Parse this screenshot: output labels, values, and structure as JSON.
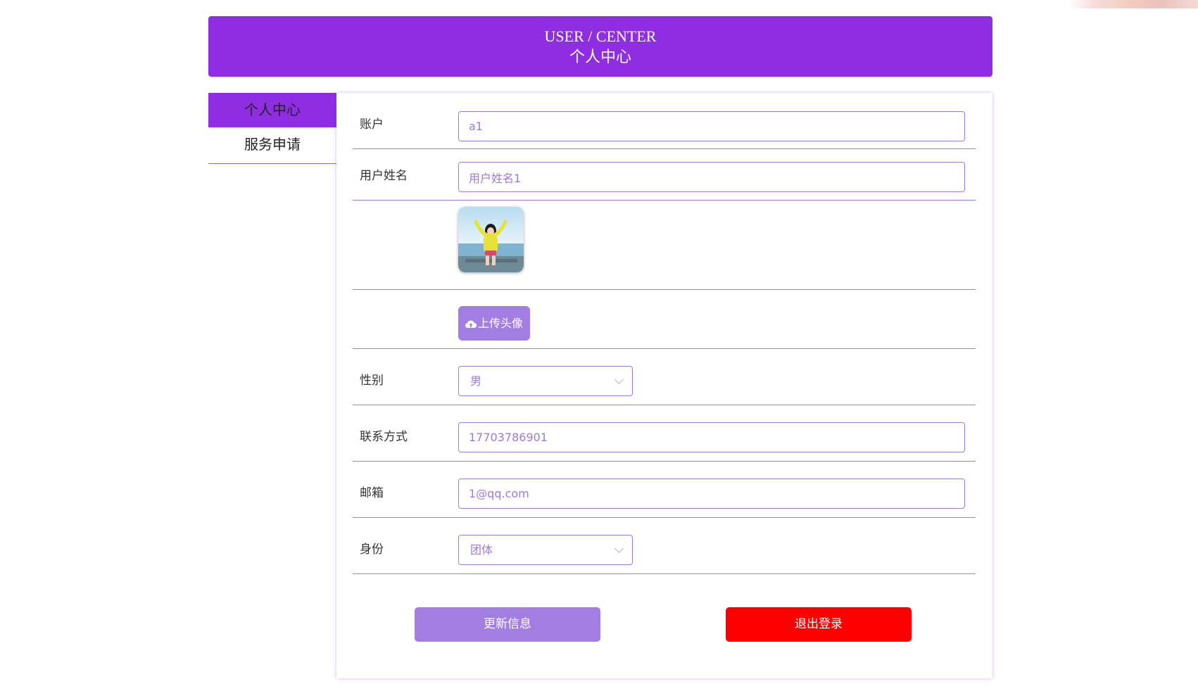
{
  "colors": {
    "accent": "#8e2de2",
    "soft_accent": "#a37ee2",
    "danger": "#ff0000",
    "input_text": "#a07ad8"
  },
  "header": {
    "title_en": "USER / CENTER",
    "title_zh": "个人中心"
  },
  "sidebar": {
    "items": [
      {
        "label": "个人中心",
        "active": true
      },
      {
        "label": "服务申请",
        "active": false
      }
    ]
  },
  "form": {
    "account": {
      "label": "账户",
      "value": "a1"
    },
    "username": {
      "label": "用户姓名",
      "value": "用户姓名1"
    },
    "avatar": {
      "icon": "avatar-photo"
    },
    "upload": {
      "label": "上传头像",
      "icon": "cloud-upload-icon"
    },
    "gender": {
      "label": "性别",
      "selected": "男"
    },
    "phone": {
      "label": "联系方式",
      "value": "17703786901"
    },
    "email": {
      "label": "邮箱",
      "value": "1@qq.com"
    },
    "identity": {
      "label": "身份",
      "selected": "团体"
    }
  },
  "actions": {
    "update_label": "更新信息",
    "logout_label": "退出登录"
  }
}
